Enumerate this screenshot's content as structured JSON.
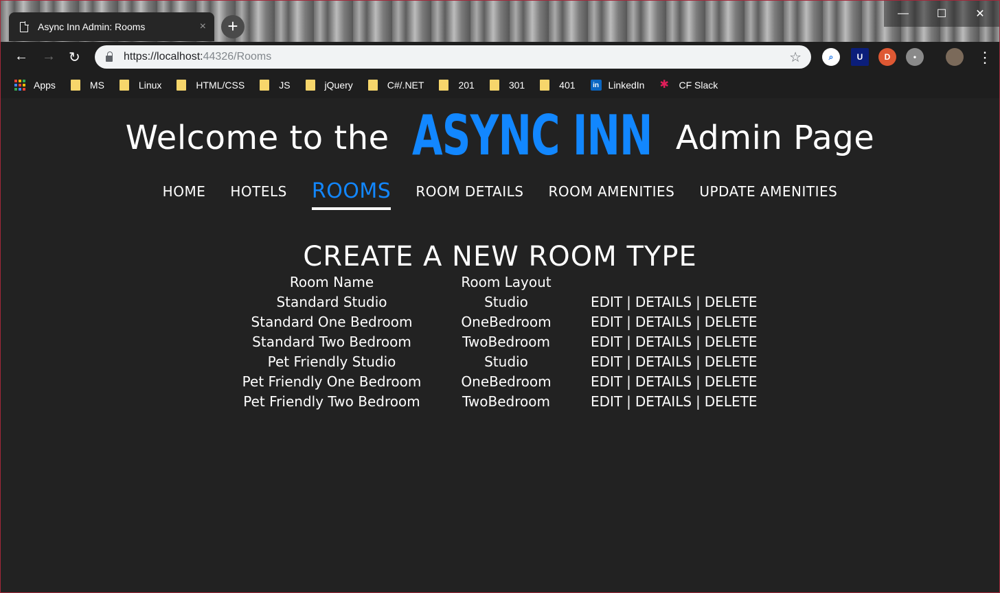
{
  "browser": {
    "tab_title": "Async Inn Admin: Rooms",
    "tab_close": "×",
    "new_tab": "+",
    "url_host": "https://localhost:",
    "url_path": "44326/Rooms",
    "back": "←",
    "forward": "→",
    "reload": "↻",
    "star": "☆",
    "menu": "⋮",
    "window_controls": {
      "minimize": "—",
      "maximize": "☐",
      "close": "✕"
    },
    "bookmarks": [
      {
        "label": "Apps",
        "icon": "apps-grid-icon"
      },
      {
        "label": "MS",
        "icon": "folder-icon"
      },
      {
        "label": "Linux",
        "icon": "folder-icon"
      },
      {
        "label": "HTML/CSS",
        "icon": "folder-icon"
      },
      {
        "label": "JS",
        "icon": "folder-icon"
      },
      {
        "label": "jQuery",
        "icon": "folder-icon"
      },
      {
        "label": "C#/.NET",
        "icon": "folder-icon"
      },
      {
        "label": "201",
        "icon": "folder-icon"
      },
      {
        "label": "301",
        "icon": "folder-icon"
      },
      {
        "label": "401",
        "icon": "folder-icon"
      },
      {
        "label": "LinkedIn",
        "icon": "linkedin-icon"
      },
      {
        "label": "CF Slack",
        "icon": "slack-icon"
      }
    ]
  },
  "header": {
    "welcome_prefix": "Welcome to the",
    "brand": "ASYNC INN",
    "welcome_suffix": "Admin Page",
    "brand_color": "#1287ff"
  },
  "nav": {
    "items": [
      {
        "label": "HOME",
        "active": false
      },
      {
        "label": "HOTELS",
        "active": false
      },
      {
        "label": "ROOMS",
        "active": true
      },
      {
        "label": "ROOM DETAILS",
        "active": false
      },
      {
        "label": "ROOM AMENITIES",
        "active": false
      },
      {
        "label": "UPDATE AMENITIES",
        "active": false
      }
    ]
  },
  "main": {
    "create_link": "CREATE A NEW ROOM TYPE",
    "table": {
      "headers": [
        "Room Name",
        "Room Layout",
        ""
      ],
      "action_labels": {
        "edit": "EDIT",
        "details": "DETAILS",
        "delete": "DELETE",
        "separator": "|"
      },
      "rows": [
        {
          "name": "Standard Studio",
          "layout": "Studio"
        },
        {
          "name": "Standard One Bedroom",
          "layout": "OneBedroom"
        },
        {
          "name": "Standard Two Bedroom",
          "layout": "TwoBedroom"
        },
        {
          "name": "Pet Friendly Studio",
          "layout": "Studio"
        },
        {
          "name": "Pet Friendly One Bedroom",
          "layout": "OneBedroom"
        },
        {
          "name": "Pet Friendly Two Bedroom",
          "layout": "TwoBedroom"
        }
      ]
    }
  }
}
